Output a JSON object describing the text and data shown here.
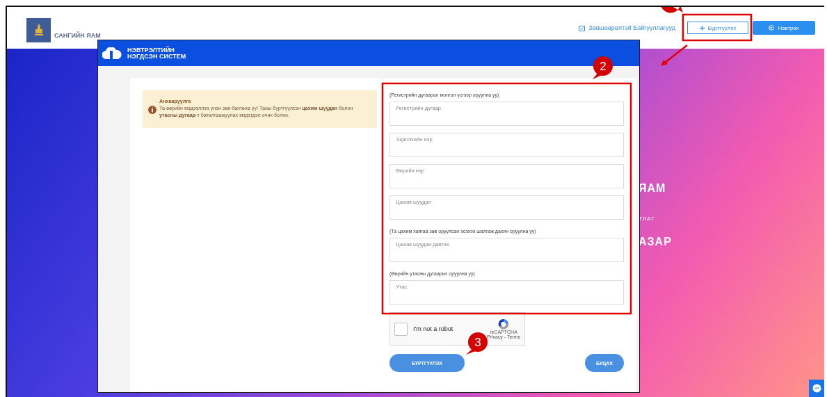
{
  "header": {
    "ministry_name": "САНГИЙН ЯАМ",
    "nav_link": "Зөвшөөрөлтэй Байгууллагууд",
    "register_button": "Бүртгүүлэх",
    "login_button": "Нэвтрэх"
  },
  "hero": {
    "lines": [
      {
        "text": "ЯАМ",
        "kind": "large"
      },
      {
        "text": "ТЛАГ",
        "kind": "small"
      },
      {
        "text": "АЗАР",
        "kind": "large"
      }
    ]
  },
  "modal": {
    "brand_lines": [
      "НЭВТРЭЛТИЙН",
      "НЭГДСЭН СИСТЕМ"
    ],
    "notice": {
      "title": "Анхааруулга",
      "text": "Та өөрийн мэдээллээ үнэн зөв бөглөнө үү! Таны бүртгүүлсэн **цахим шуудан** болон **утасны дугаар**-т баталгаажуулах мэдэгдэл очих болно."
    },
    "form": [
      {
        "kind": "hint",
        "text": "(Регистрийн дугаарыг монгол үсгээр оруулна уу)"
      },
      {
        "kind": "field",
        "placeholder": "Регистрийн дугаар"
      },
      {
        "kind": "field",
        "placeholder": "Эцэг/эхийн нэр"
      },
      {
        "kind": "field",
        "placeholder": "Өөрийн нэр"
      },
      {
        "kind": "field",
        "placeholder": "Цахим шуудан"
      },
      {
        "kind": "hint",
        "text": "(Та цахим хаягаа зөв оруулсан эсэхээ шалгаж дахин оруулна уу)"
      },
      {
        "kind": "field",
        "placeholder": "Цахим шуудан давтах"
      },
      {
        "kind": "hint",
        "text": "(Өөрийн утасны дугаарыг оруулна уу)"
      },
      {
        "kind": "field",
        "placeholder": "Утас"
      }
    ],
    "captcha": {
      "checked": false,
      "label": "I'm not a robot",
      "brand": "reCAPTCHA",
      "links": "Privacy - Terms"
    },
    "submit_button": "БҮРТГҮҮЛЭХ",
    "back_button": "БУЦАХ"
  },
  "annotations": [
    {
      "label": "2"
    },
    {
      "label": "3"
    }
  ]
}
